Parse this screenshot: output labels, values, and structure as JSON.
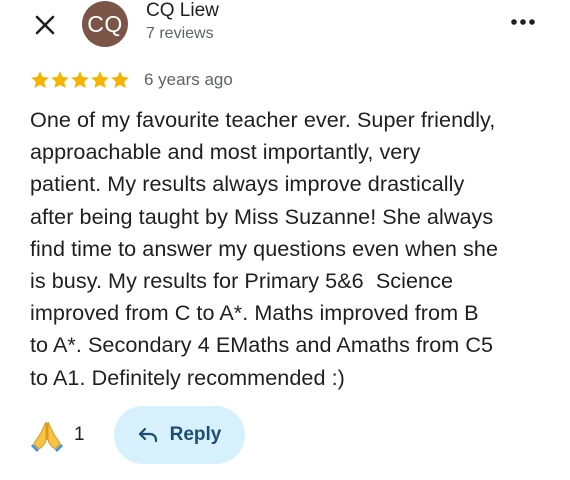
{
  "header": {
    "avatar_initials": "CQ",
    "avatar_color": "#7a5548",
    "reviewer_name": "CQ Liew",
    "review_count": "7 reviews",
    "close_icon": "close-icon",
    "more_icon": "more-horizontal-icon"
  },
  "review": {
    "rating": 5,
    "max_rating": 5,
    "star_color": "#f4b400",
    "time": "6 years ago",
    "lines": [
      "One of my favourite teacher ever. Super friendly,",
      "approachable and most importantly, very",
      "patient. My results always improve drastically",
      "after being taught by Miss Suzanne! She always",
      "find time to answer my questions even when she",
      "is busy. My results for Primary 5&6  Science",
      "improved from C to A*. Maths improved from B",
      "to A*. Secondary 4 EMaths and Amaths from C5",
      "to A1. Definitely recommended :)"
    ]
  },
  "actions": {
    "reaction_icon": "folded-hands-icon",
    "reaction_count": "1",
    "reply_icon": "reply-arrow-icon",
    "reply_label": "Reply",
    "reply_bg": "#d6f1fb"
  }
}
